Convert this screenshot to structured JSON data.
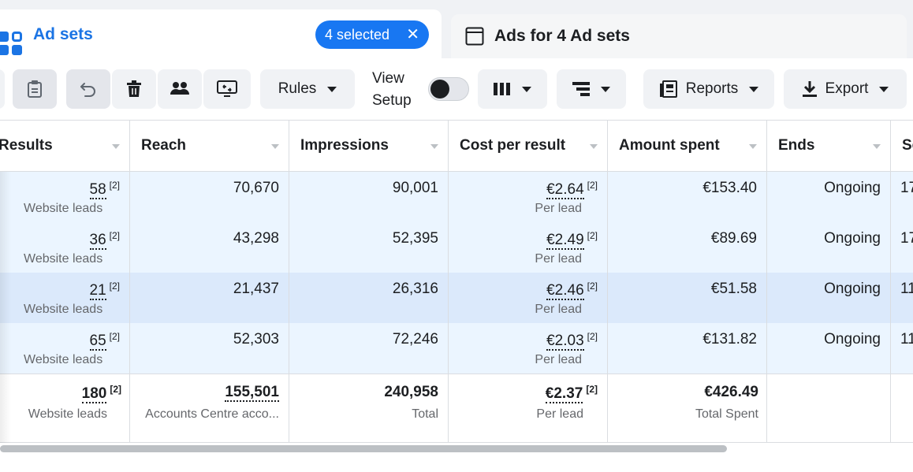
{
  "tabs": {
    "ad_sets_label": "Ad sets",
    "selected_label": "4 selected",
    "ads_label": "Ads for 4 Ad sets"
  },
  "toolbar": {
    "rules_label": "Rules",
    "view_setup_line1": "View",
    "view_setup_line2": "Setup",
    "reports_label": "Reports",
    "export_label": "Export"
  },
  "columns": [
    "Results",
    "Reach",
    "Impressions",
    "Cost per result",
    "Amount spent",
    "Ends",
    "Sc"
  ],
  "rows": [
    {
      "results": "58",
      "results_sup": "[2]",
      "results_sub": "Website leads",
      "reach": "70,670",
      "impressions": "90,001",
      "cpr": "€2.64",
      "cpr_sup": "[2]",
      "cpr_sub": "Per lead",
      "spent": "€153.40",
      "ends": "Ongoing",
      "extra": "17",
      "highlight": false
    },
    {
      "results": "36",
      "results_sup": "[2]",
      "results_sub": "Website leads",
      "reach": "43,298",
      "impressions": "52,395",
      "cpr": "€2.49",
      "cpr_sup": "[2]",
      "cpr_sub": "Per lead",
      "spent": "€89.69",
      "ends": "Ongoing",
      "extra": "17",
      "highlight": false
    },
    {
      "results": "21",
      "results_sup": "[2]",
      "results_sub": "Website leads",
      "reach": "21,437",
      "impressions": "26,316",
      "cpr": "€2.46",
      "cpr_sup": "[2]",
      "cpr_sub": "Per lead",
      "spent": "€51.58",
      "ends": "Ongoing",
      "extra": "11",
      "highlight": true
    },
    {
      "results": "65",
      "results_sup": "[2]",
      "results_sub": "Website leads",
      "reach": "52,303",
      "impressions": "72,246",
      "cpr": "€2.03",
      "cpr_sup": "[2]",
      "cpr_sub": "Per lead",
      "spent": "€131.82",
      "ends": "Ongoing",
      "extra": "11",
      "highlight": false
    }
  ],
  "totals": {
    "results": "180",
    "results_sup": "[2]",
    "results_sub": "Website leads",
    "reach": "155,501",
    "reach_sub": "Accounts Centre acco...",
    "impressions": "240,958",
    "impressions_sub": "Total",
    "cpr": "€2.37",
    "cpr_sup": "[2]",
    "cpr_sub": "Per lead",
    "spent": "€426.49",
    "spent_sub": "Total Spent"
  },
  "colors": {
    "accent": "#1877f2",
    "row_selected": "#ebf5ff",
    "row_highlight": "#dbe9fb"
  }
}
